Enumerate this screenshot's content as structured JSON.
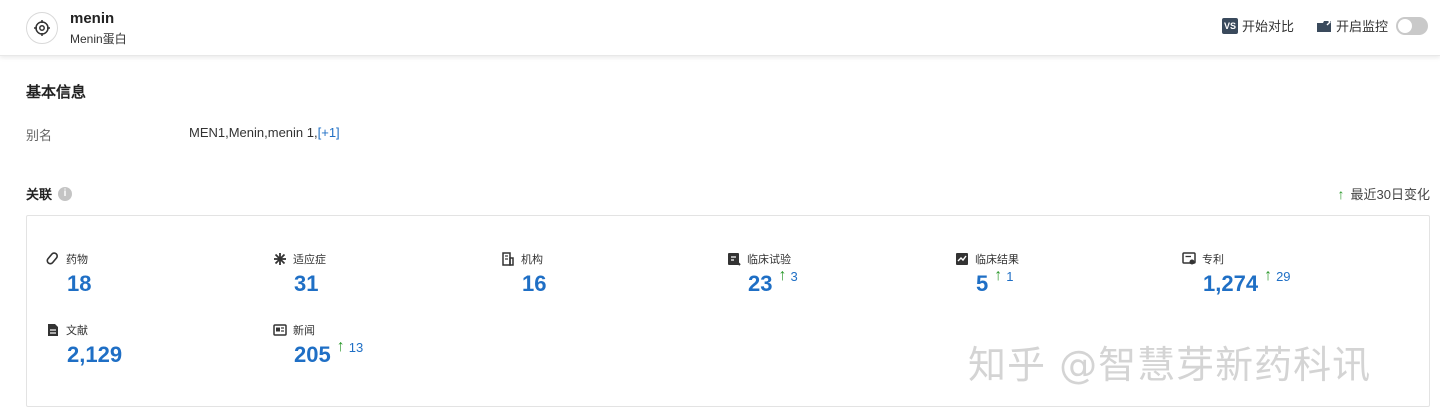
{
  "header": {
    "title": "menin",
    "subtitle": "Menin蛋白",
    "compare_badge": "VS",
    "compare_label": "开始对比",
    "monitor_label": "开启监控"
  },
  "basic_info": {
    "title": "基本信息",
    "alias_label": "别名",
    "alias_value": "MEN1,Menin,menin 1,",
    "alias_more": "[+1]"
  },
  "relations": {
    "title": "关联",
    "info_glyph": "i",
    "recent_arrow": "↑",
    "recent_label": "最近30日变化",
    "items": [
      {
        "icon": "pill-icon",
        "label": "药物",
        "value": "18",
        "delta": ""
      },
      {
        "icon": "snowflake-icon",
        "label": "适应症",
        "value": "31",
        "delta": ""
      },
      {
        "icon": "building-icon",
        "label": "机构",
        "value": "16",
        "delta": ""
      },
      {
        "icon": "clinical-trial-icon",
        "label": "临床试验",
        "value": "23",
        "delta": "3"
      },
      {
        "icon": "clinical-result-icon",
        "label": "临床结果",
        "value": "5",
        "delta": "1"
      },
      {
        "icon": "patent-icon",
        "label": "专利",
        "value": "1,274",
        "delta": "29"
      },
      {
        "icon": "document-icon",
        "label": "文献",
        "value": "2,129",
        "delta": ""
      },
      {
        "icon": "news-icon",
        "label": "新闻",
        "value": "205",
        "delta": "13"
      }
    ],
    "delta_arrow": "↑"
  },
  "watermark": "知乎 @智慧芽新药科讯",
  "colors": {
    "accent": "#1f6fc5",
    "up": "#2e9a2e"
  }
}
